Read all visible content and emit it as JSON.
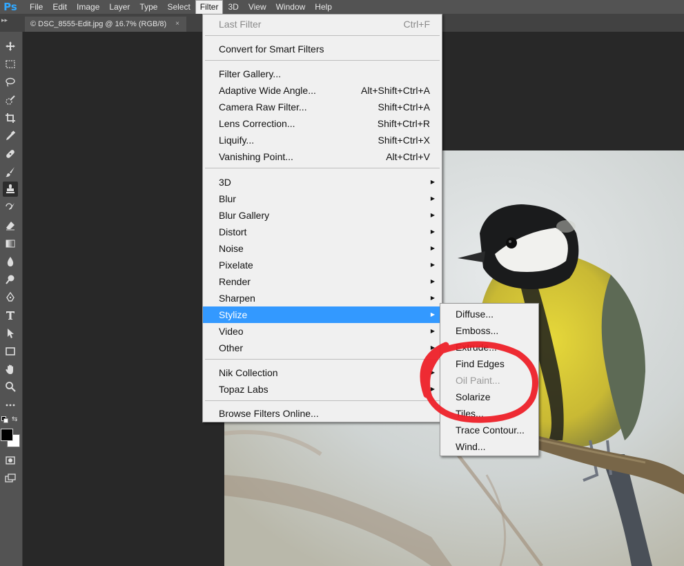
{
  "app": {
    "logo": "Ps"
  },
  "menubar": {
    "items": [
      "File",
      "Edit",
      "Image",
      "Layer",
      "Type",
      "Select",
      "Filter",
      "3D",
      "View",
      "Window",
      "Help"
    ],
    "active": "Filter"
  },
  "document_tab": {
    "title": "© DSC_8555-Edit.jpg @ 16.7% (RGB/8)",
    "close": "×"
  },
  "filter_menu": {
    "last_filter": {
      "label": "Last Filter",
      "shortcut": "Ctrl+F"
    },
    "convert_smart": {
      "label": "Convert for Smart Filters"
    },
    "filter_gallery": {
      "label": "Filter Gallery..."
    },
    "adaptive_wide": {
      "label": "Adaptive Wide Angle...",
      "shortcut": "Alt+Shift+Ctrl+A"
    },
    "camera_raw": {
      "label": "Camera Raw Filter...",
      "shortcut": "Shift+Ctrl+A"
    },
    "lens_correction": {
      "label": "Lens Correction...",
      "shortcut": "Shift+Ctrl+R"
    },
    "liquify": {
      "label": "Liquify...",
      "shortcut": "Shift+Ctrl+X"
    },
    "vanishing_point": {
      "label": "Vanishing Point...",
      "shortcut": "Alt+Ctrl+V"
    },
    "threed": {
      "label": "3D"
    },
    "blur": {
      "label": "Blur"
    },
    "blur_gallery": {
      "label": "Blur Gallery"
    },
    "distort": {
      "label": "Distort"
    },
    "noise": {
      "label": "Noise"
    },
    "pixelate": {
      "label": "Pixelate"
    },
    "render": {
      "label": "Render"
    },
    "sharpen": {
      "label": "Sharpen"
    },
    "stylize": {
      "label": "Stylize"
    },
    "video": {
      "label": "Video"
    },
    "other": {
      "label": "Other"
    },
    "nik": {
      "label": "Nik Collection"
    },
    "topaz": {
      "label": "Topaz Labs"
    },
    "browse_online": {
      "label": "Browse Filters Online..."
    }
  },
  "stylize_submenu": {
    "diffuse": "Diffuse...",
    "emboss": "Emboss...",
    "extrude": "Extrude...",
    "find_edges": "Find Edges",
    "oil_paint": "Oil Paint...",
    "solarize": "Solarize",
    "tiles": "Tiles...",
    "trace_contour": "Trace Contour...",
    "wind": "Wind..."
  },
  "colors": {
    "highlight": "#3399ff",
    "annotation": "#ee1c25",
    "menubar": "#535353"
  }
}
